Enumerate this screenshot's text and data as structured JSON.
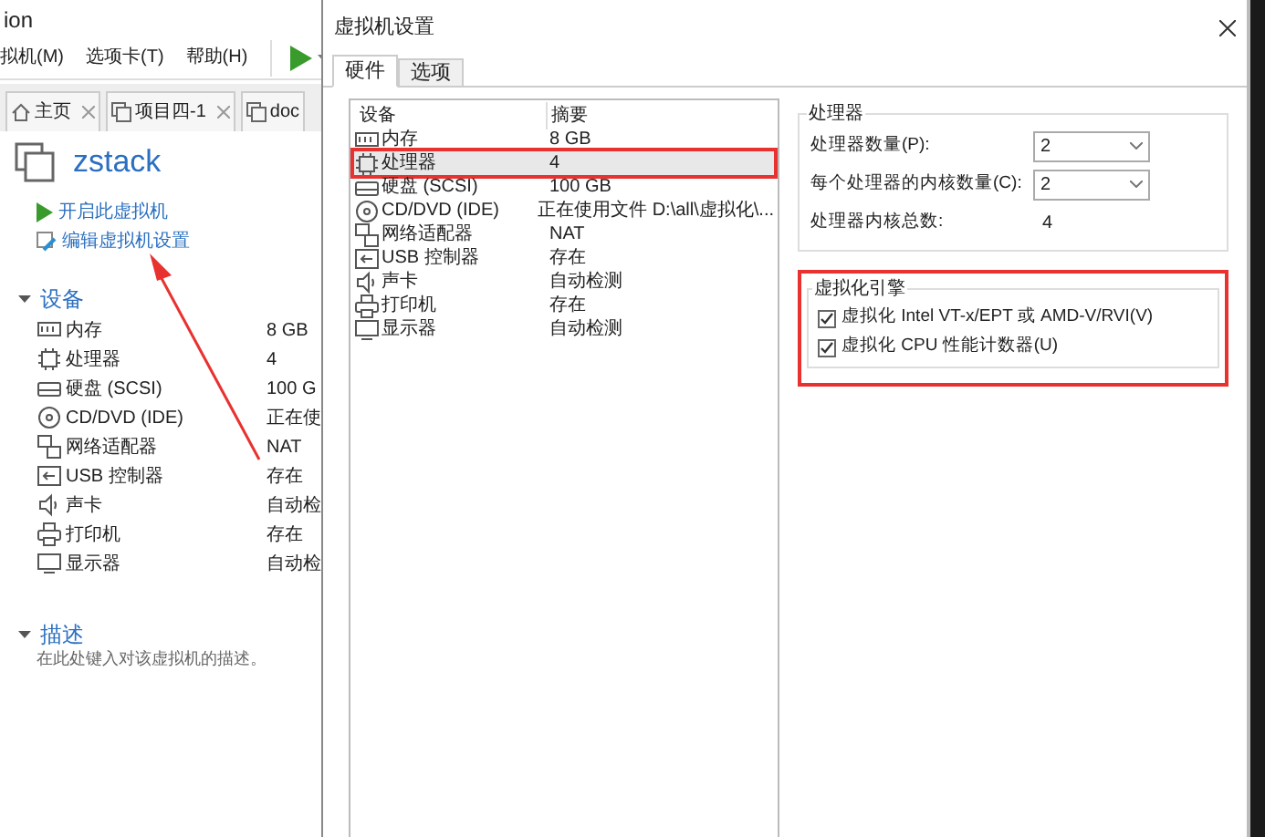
{
  "app": {
    "title": "ion",
    "menu": [
      "拟机(M)",
      "选项卡(T)",
      "帮助(H)"
    ],
    "tabs": [
      {
        "label": "主页",
        "kind": "home",
        "closable": true
      },
      {
        "label": "项目四-1",
        "kind": "vm",
        "closable": true
      },
      {
        "label": "doc",
        "kind": "vm",
        "closable": false
      }
    ],
    "vm_name": "zstack",
    "actions": [
      {
        "label": "开启此虚拟机",
        "kind": "power"
      },
      {
        "label": "编辑虚拟机设置",
        "kind": "edit"
      }
    ],
    "devices_heading": "设备",
    "devices": [
      {
        "name": "内存",
        "value": "8 GB",
        "kind": "memory"
      },
      {
        "name": "处理器",
        "value": "4",
        "kind": "cpu"
      },
      {
        "name": "硬盘 (SCSI)",
        "value": "100 G",
        "kind": "disk"
      },
      {
        "name": "CD/DVD (IDE)",
        "value": "正在使",
        "kind": "cd"
      },
      {
        "name": "网络适配器",
        "value": "NAT",
        "kind": "network"
      },
      {
        "name": "USB 控制器",
        "value": "存在",
        "kind": "usb"
      },
      {
        "name": "声卡",
        "value": "自动检",
        "kind": "sound"
      },
      {
        "name": "打印机",
        "value": "存在",
        "kind": "printer"
      },
      {
        "name": "显示器",
        "value": "自动检",
        "kind": "display"
      }
    ],
    "description_heading": "描述",
    "description_placeholder": "在此处键入对该虚拟机的描述。"
  },
  "dialog": {
    "title": "虚拟机设置",
    "tabs": [
      {
        "label": "硬件",
        "selected": true
      },
      {
        "label": "选项",
        "selected": false
      }
    ],
    "columns": [
      "设备",
      "摘要"
    ],
    "rows": [
      {
        "device": "内存",
        "summary": "8 GB",
        "kind": "memory",
        "selected": false
      },
      {
        "device": "处理器",
        "summary": "4",
        "kind": "cpu",
        "selected": true
      },
      {
        "device": "硬盘 (SCSI)",
        "summary": "100 GB",
        "kind": "disk",
        "selected": false
      },
      {
        "device": "CD/DVD (IDE)",
        "summary": "正在使用文件 D:\\all\\虚拟化\\...",
        "kind": "cd",
        "selected": false
      },
      {
        "device": "网络适配器",
        "summary": "NAT",
        "kind": "network",
        "selected": false
      },
      {
        "device": "USB 控制器",
        "summary": "存在",
        "kind": "usb",
        "selected": false
      },
      {
        "device": "声卡",
        "summary": "自动检测",
        "kind": "sound",
        "selected": false
      },
      {
        "device": "打印机",
        "summary": "存在",
        "kind": "printer",
        "selected": false
      },
      {
        "device": "显示器",
        "summary": "自动检测",
        "kind": "display",
        "selected": false
      }
    ],
    "processor_group": {
      "title": "处理器",
      "fields": [
        {
          "label": "处理器数量(P):",
          "kind": "select",
          "value": "2"
        },
        {
          "label": "每个处理器的内核数量(C):",
          "kind": "select",
          "value": "2"
        },
        {
          "label": "处理器内核总数:",
          "kind": "text",
          "value": "4"
        }
      ]
    },
    "virtualization_group": {
      "title": "虚拟化引擎",
      "options": [
        {
          "label": "虚拟化 Intel VT-x/EPT 或 AMD-V/RVI(V)",
          "checked": true
        },
        {
          "label": "虚拟化 CPU 性能计数器(U)",
          "checked": true
        }
      ]
    }
  }
}
